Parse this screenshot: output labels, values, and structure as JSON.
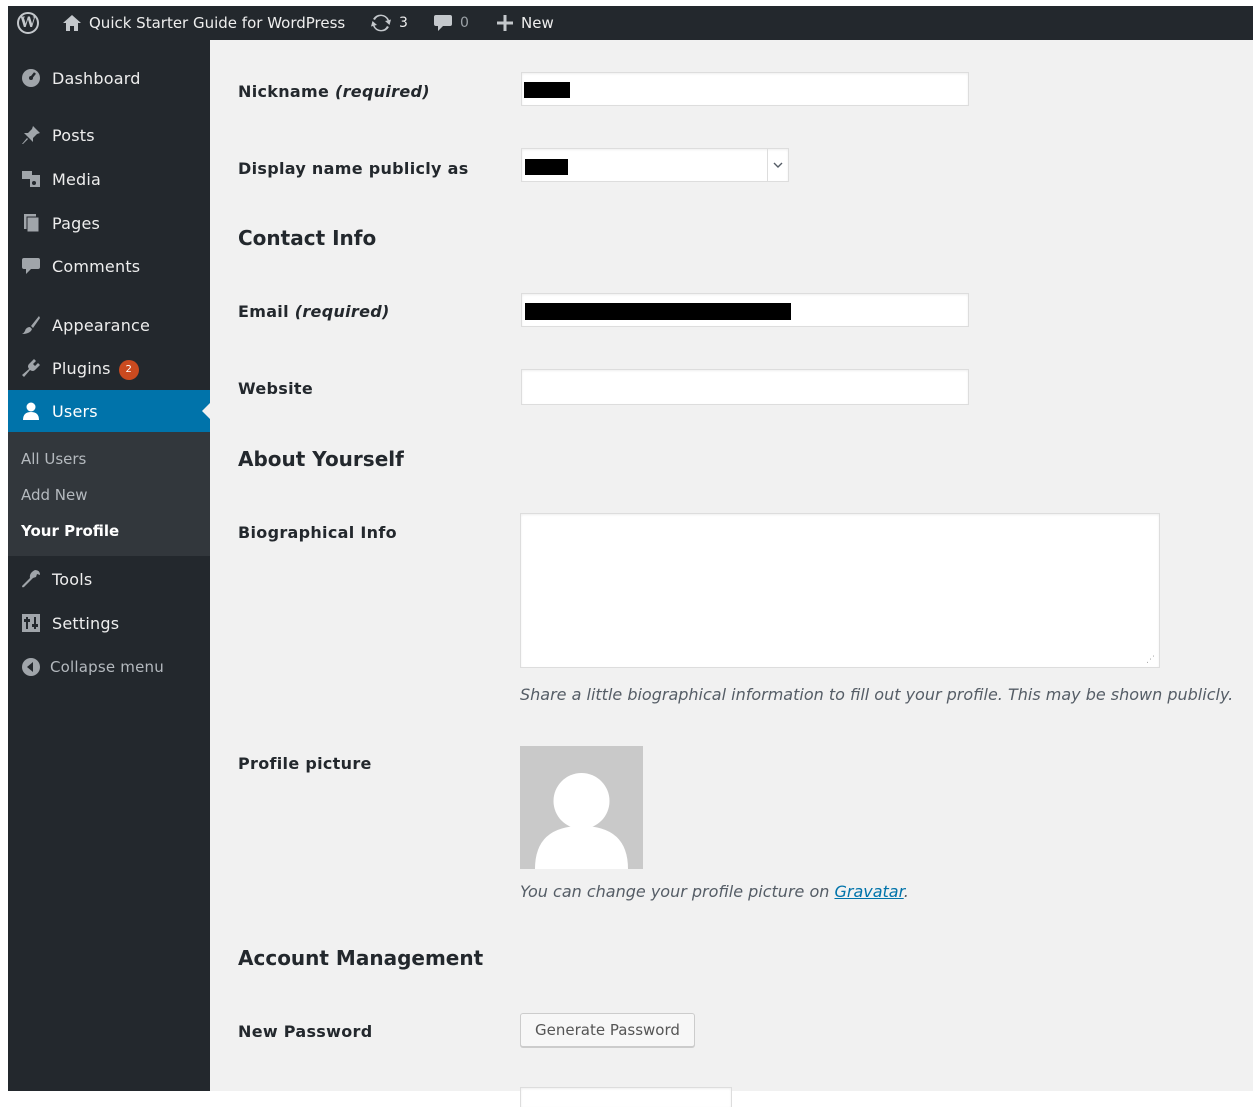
{
  "adminbar": {
    "site_name": "Quick Starter Guide for WordPress",
    "updates_count": "3",
    "comments_count": "0",
    "new_label": "New"
  },
  "sidebar": {
    "items": [
      {
        "label": "Dashboard",
        "icon": "dashboard-icon"
      },
      {
        "label": "Posts",
        "icon": "pin-icon"
      },
      {
        "label": "Media",
        "icon": "media-icon"
      },
      {
        "label": "Pages",
        "icon": "pages-icon"
      },
      {
        "label": "Comments",
        "icon": "comment-icon"
      },
      {
        "label": "Appearance",
        "icon": "brush-icon"
      },
      {
        "label": "Plugins",
        "icon": "plugin-icon",
        "badge": "2"
      },
      {
        "label": "Users",
        "icon": "user-icon",
        "active": true
      },
      {
        "label": "Tools",
        "icon": "wrench-icon"
      },
      {
        "label": "Settings",
        "icon": "settings-icon"
      }
    ],
    "submenu": [
      "All Users",
      "Add New",
      "Your Profile"
    ],
    "collapse_label": "Collapse menu"
  },
  "form": {
    "nickname_label": "Nickname",
    "nickname_required": "(required)",
    "display_name_label": "Display name publicly as",
    "contact_info_title": "Contact Info",
    "email_label": "Email",
    "email_required": "(required)",
    "website_label": "Website",
    "about_title": "About Yourself",
    "bio_label": "Biographical Info",
    "bio_help": "Share a little biographical information to fill out your profile. This may be shown publicly.",
    "profile_picture_label": "Profile picture",
    "picture_help_prefix": "You can change your profile picture on ",
    "picture_help_link": "Gravatar",
    "picture_help_suffix": ".",
    "account_title": "Account Management",
    "new_password_label": "New Password",
    "generate_password_button": "Generate Password"
  },
  "colors": {
    "adminbar_bg": "#23282d",
    "sidebar_bg": "#23282d",
    "submenu_bg": "#32373c",
    "active_bg": "#0073aa",
    "badge_bg": "#ca4a1f",
    "content_bg": "#f1f1f1",
    "link": "#0073aa"
  }
}
